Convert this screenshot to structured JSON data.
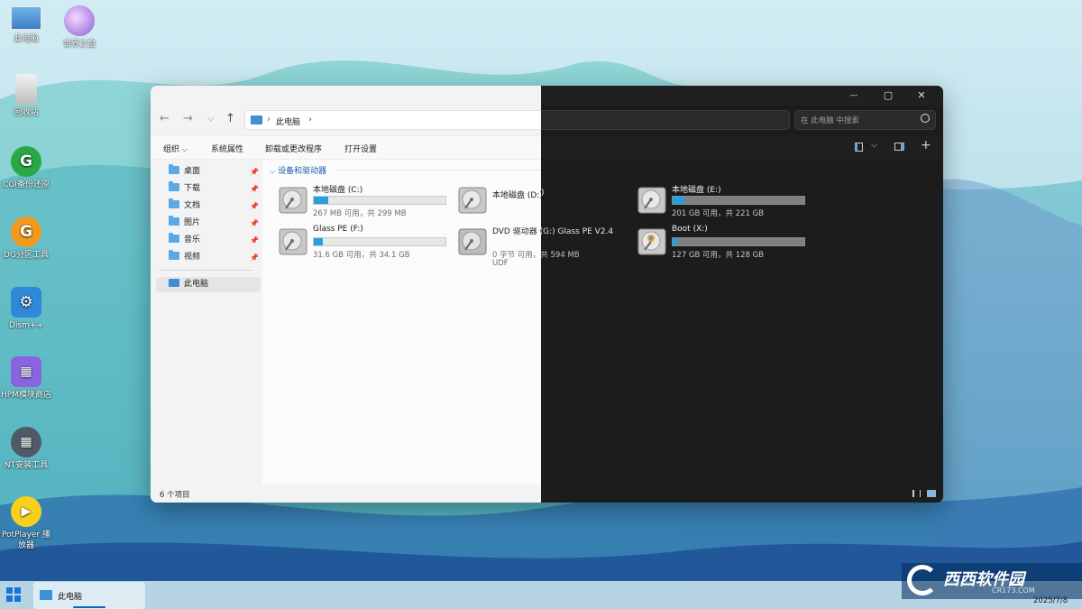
{
  "desktop": {
    "icons": [
      {
        "label": "此电脑",
        "icon": "computer-icon"
      },
      {
        "label": "世界之窗",
        "icon": "browser-icon"
      },
      {
        "label": "回收站",
        "icon": "recycle-bin-icon"
      },
      {
        "label": "CGI备份还原",
        "icon": "cgi-icon"
      },
      {
        "label": "DG分区工具",
        "icon": "diskgenius-icon"
      },
      {
        "label": "Dism++",
        "icon": "gears-icon"
      },
      {
        "label": "HPM模块商店",
        "icon": "module-store-icon"
      },
      {
        "label": "NT安装工具",
        "icon": "installer-icon"
      },
      {
        "label": "PotPlayer 播放器",
        "icon": "play-icon"
      }
    ]
  },
  "explorer": {
    "breadcrumb": {
      "location": "此电脑",
      "sep": "›",
      "end": "›"
    },
    "search_placeholder": "在 此电脑 中搜索",
    "nav_glyphs": {
      "back": "←",
      "forward": "→",
      "down": "⌵",
      "up": "↑"
    },
    "toolbar": {
      "organize": "组织",
      "organize_caret": "⌵",
      "system_properties": "系统属性",
      "uninstall": "卸载或更改程序",
      "open_settings": "打开设置"
    },
    "window_controls": {
      "minimize": "—",
      "maximize": "▢",
      "close": "✕"
    },
    "quick_access": [
      {
        "label": "桌面"
      },
      {
        "label": "下载"
      },
      {
        "label": "文档"
      },
      {
        "label": "图片"
      },
      {
        "label": "音乐"
      },
      {
        "label": "视频"
      }
    ],
    "this_pc_label": "此电脑",
    "group_header": "设备和驱动器",
    "group_caret": "⌵",
    "drives": [
      {
        "name": "本地磁盘 (C:)",
        "free": "267 MB 可用，共 299 MB",
        "used_fraction": 0.11
      },
      {
        "name": "本地磁盘 (D:)",
        "free": "",
        "used_fraction": 0
      },
      {
        "name": "本地磁盘 (E:)",
        "free": "201 GB 可用，共 221 GB",
        "used_fraction": 0.09
      },
      {
        "name": "Glass PE (F:)",
        "free": "31.6 GB 可用，共 34.1 GB",
        "used_fraction": 0.07
      },
      {
        "name": "DVD 驱动器 (G:) Glass PE V2.4",
        "free": "0 字节 可用，共 594 MB",
        "extra": "UDF",
        "used_fraction": 1
      },
      {
        "name": "Boot (X:)",
        "free": "127 GB 可用，共 128 GB",
        "used_fraction": 0.01
      }
    ],
    "status": "6 个项目"
  },
  "taskbar": {
    "app_label": "此电脑",
    "date": "2025/7/8"
  },
  "watermark": {
    "text": "西西软件园",
    "sub": "CR173.COM"
  },
  "colors": {
    "accent": "#26a0da",
    "dark_bg": "#1c1c1c",
    "light_bg": "#f3f3f3"
  }
}
